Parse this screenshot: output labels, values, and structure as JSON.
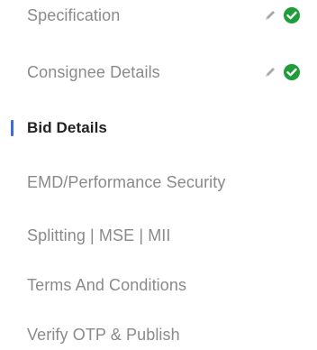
{
  "steps": [
    {
      "label": "Specification",
      "completed": true,
      "editable": true,
      "active": false
    },
    {
      "label": "Consignee Details",
      "completed": true,
      "editable": true,
      "active": false
    },
    {
      "label": "Bid Details",
      "completed": false,
      "editable": false,
      "active": true
    },
    {
      "label": "EMD/Performance Security",
      "completed": false,
      "editable": false,
      "active": false
    },
    {
      "label": "Splitting | MSE | MII",
      "completed": false,
      "editable": false,
      "active": false
    },
    {
      "label": "Terms And Conditions",
      "completed": false,
      "editable": false,
      "active": false
    },
    {
      "label": "Verify OTP & Publish",
      "completed": false,
      "editable": false,
      "active": false
    }
  ],
  "colors": {
    "check": "#1f9d3a",
    "edit": "#9a9a9a",
    "active_marker": "#3b6fd1",
    "active_text": "#222222",
    "inactive_text": "#8a8a8a"
  },
  "icons": {
    "edit": "pencil-icon",
    "completed": "check-circle-icon"
  }
}
